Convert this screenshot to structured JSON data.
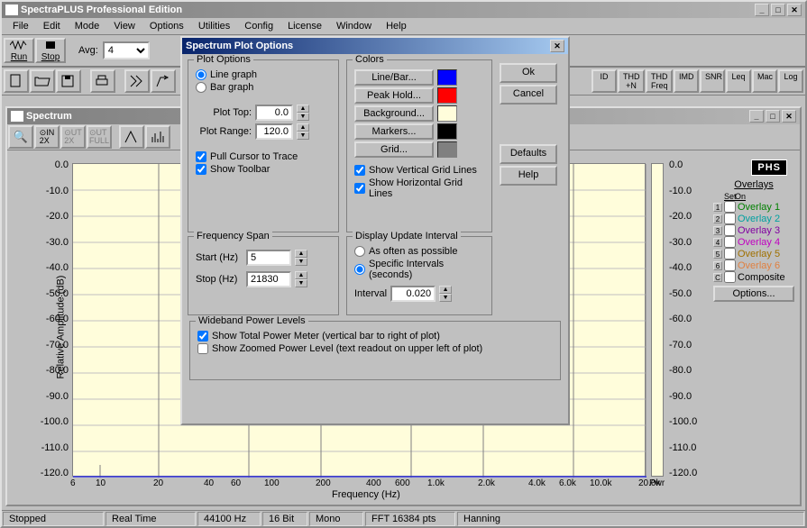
{
  "app": {
    "title": "SpectraPLUS Professional Edition"
  },
  "menu": {
    "file": "File",
    "edit": "Edit",
    "mode": "Mode",
    "view": "View",
    "options": "Options",
    "utilities": "Utilities",
    "config": "Config",
    "license": "License",
    "window": "Window",
    "help": "Help"
  },
  "toolbar": {
    "run": "Run",
    "stop": "Stop",
    "avg_label": "Avg:",
    "avg_value": "4"
  },
  "metric_buttons": [
    "ID",
    "THD\n+N",
    "THD\nFreq",
    "IMD",
    "SNR",
    "Leq",
    "Mac",
    "Log"
  ],
  "spectrum": {
    "title": "Spectrum",
    "ylabel": "Relative Amplitude (dB)",
    "xlabel": "Frequency (Hz)",
    "y_ticks": [
      "0.0",
      "-10.0",
      "-20.0",
      "-30.0",
      "-40.0",
      "-50.0",
      "-60.0",
      "-70.0",
      "-80.0",
      "-90.0",
      "-100.0",
      "-110.0",
      "-120.0"
    ],
    "x_ticks": [
      "6",
      "10",
      "20",
      "40",
      "60",
      "100",
      "200",
      "400",
      "600",
      "1.0k",
      "2.0k",
      "4.0k",
      "6.0k",
      "10.0k",
      "20.0k"
    ],
    "pwr_label": "Pwr",
    "phs_badge": "PHS",
    "overlays_title": "Overlays",
    "overlays_set": "Set",
    "overlays_on": "On",
    "overlay_items": [
      "Overlay 1",
      "Overlay 2",
      "Overlay 3",
      "Overlay 4",
      "Overlay 5",
      "Overlay 6",
      "Composite"
    ],
    "overlay_nums": [
      "1",
      "2",
      "3",
      "4",
      "5",
      "6",
      "C"
    ],
    "overlay_colors": [
      "#008000",
      "#00a0a0",
      "#8000a0",
      "#c000c0",
      "#a07000",
      "#e08040",
      "#000"
    ],
    "overlay_options_btn": "Options..."
  },
  "dialog": {
    "title": "Spectrum Plot Options",
    "plot_options": "Plot Options",
    "line_graph": "Line graph",
    "bar_graph": "Bar graph",
    "plot_top": "Plot Top:",
    "plot_top_val": "0.0",
    "plot_range": "Plot Range:",
    "plot_range_val": "120.0",
    "pull_cursor": "Pull Cursor to Trace",
    "show_toolbar": "Show Toolbar",
    "freq_span": "Frequency Span",
    "start_hz": "Start (Hz)",
    "start_val": "5",
    "stop_hz": "Stop (Hz)",
    "stop_val": "21830",
    "wideband": "Wideband Power Levels",
    "show_total": "Show Total Power Meter (vertical bar to right of plot)",
    "show_zoomed": "Show Zoomed Power Level (text readout on upper left of plot)",
    "colors": "Colors",
    "linebar_btn": "Line/Bar...",
    "peakhold_btn": "Peak Hold...",
    "background_btn": "Background...",
    "markers_btn": "Markers...",
    "grid_btn": "Grid...",
    "show_vgrid": "Show Vertical Grid Lines",
    "show_hgrid": "Show Horizontal Grid Lines",
    "dui": "Display Update Interval",
    "asap": "As often as possible",
    "specific": "Specific Intervals (seconds)",
    "interval": "Interval",
    "interval_val": "0.020",
    "ok": "Ok",
    "cancel": "Cancel",
    "defaults": "Defaults",
    "help": "Help",
    "color_swatches": {
      "linebar": "#0000ff",
      "peakhold": "#ff0000",
      "background": "#fffddb",
      "markers": "#000000",
      "grid": "#808080"
    }
  },
  "status": {
    "s1": "Stopped",
    "s2": "Real Time",
    "s3": "44100 Hz",
    "s4": "16 Bit",
    "s5": "Mono",
    "s6": "FFT 16384 pts",
    "s7": "Hanning"
  }
}
